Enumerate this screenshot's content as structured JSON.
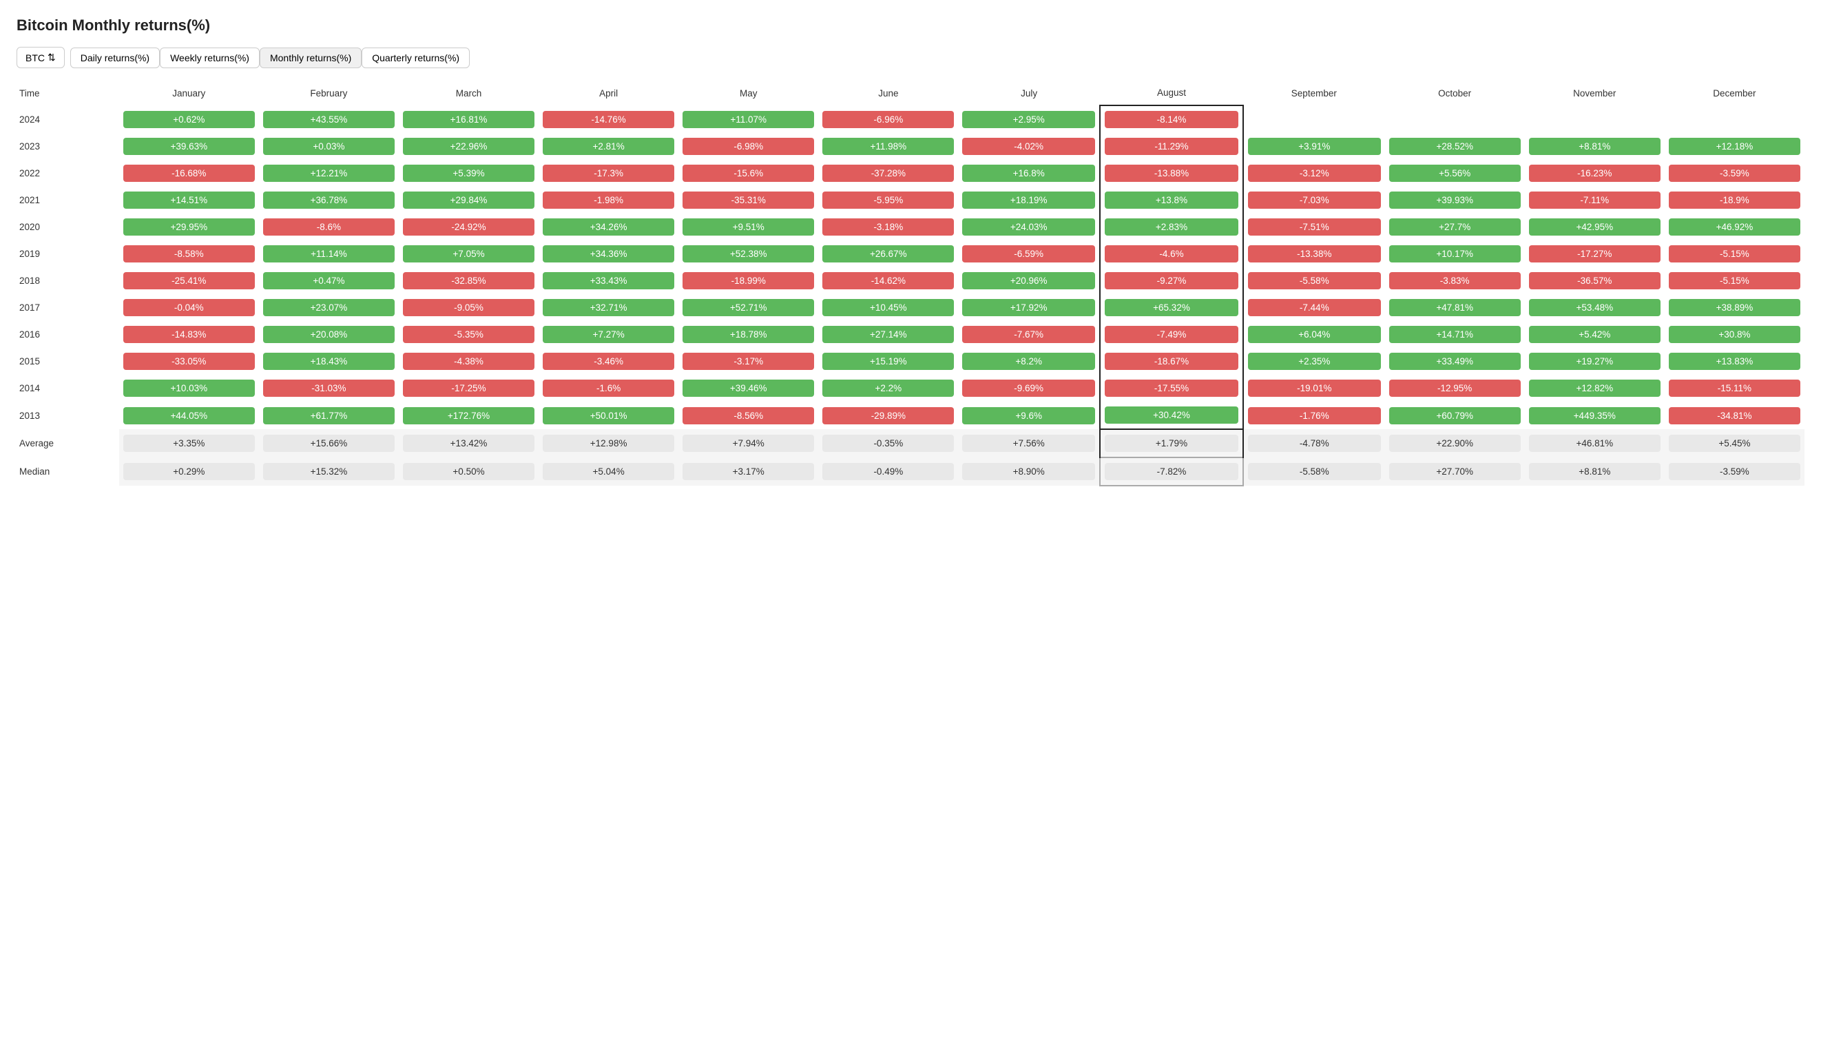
{
  "title": "Bitcoin Monthly returns(%)",
  "toolbar": {
    "asset": "BTC",
    "tabs": [
      {
        "label": "Daily returns(%)",
        "active": false
      },
      {
        "label": "Weekly returns(%)",
        "active": false
      },
      {
        "label": "Monthly returns(%)",
        "active": true
      },
      {
        "label": "Quarterly returns(%)",
        "active": false
      }
    ]
  },
  "columns": [
    "Time",
    "January",
    "February",
    "March",
    "April",
    "May",
    "June",
    "July",
    "August",
    "September",
    "October",
    "November",
    "December"
  ],
  "rows": [
    {
      "year": "2024",
      "values": [
        "+0.62%",
        "+43.55%",
        "+16.81%",
        "-14.76%",
        "+11.07%",
        "-6.96%",
        "+2.95%",
        "-8.14%",
        "",
        "",
        "",
        ""
      ]
    },
    {
      "year": "2023",
      "values": [
        "+39.63%",
        "+0.03%",
        "+22.96%",
        "+2.81%",
        "-6.98%",
        "+11.98%",
        "-4.02%",
        "-11.29%",
        "+3.91%",
        "+28.52%",
        "+8.81%",
        "+12.18%"
      ]
    },
    {
      "year": "2022",
      "values": [
        "-16.68%",
        "+12.21%",
        "+5.39%",
        "-17.3%",
        "-15.6%",
        "-37.28%",
        "+16.8%",
        "-13.88%",
        "-3.12%",
        "+5.56%",
        "-16.23%",
        "-3.59%"
      ]
    },
    {
      "year": "2021",
      "values": [
        "+14.51%",
        "+36.78%",
        "+29.84%",
        "-1.98%",
        "-35.31%",
        "-5.95%",
        "+18.19%",
        "+13.8%",
        "-7.03%",
        "+39.93%",
        "-7.11%",
        "-18.9%"
      ]
    },
    {
      "year": "2020",
      "values": [
        "+29.95%",
        "-8.6%",
        "-24.92%",
        "+34.26%",
        "+9.51%",
        "-3.18%",
        "+24.03%",
        "+2.83%",
        "-7.51%",
        "+27.7%",
        "+42.95%",
        "+46.92%"
      ]
    },
    {
      "year": "2019",
      "values": [
        "-8.58%",
        "+11.14%",
        "+7.05%",
        "+34.36%",
        "+52.38%",
        "+26.67%",
        "-6.59%",
        "-4.6%",
        "-13.38%",
        "+10.17%",
        "-17.27%",
        "-5.15%"
      ]
    },
    {
      "year": "2018",
      "values": [
        "-25.41%",
        "+0.47%",
        "-32.85%",
        "+33.43%",
        "-18.99%",
        "-14.62%",
        "+20.96%",
        "-9.27%",
        "-5.58%",
        "-3.83%",
        "-36.57%",
        "-5.15%"
      ]
    },
    {
      "year": "2017",
      "values": [
        "-0.04%",
        "+23.07%",
        "-9.05%",
        "+32.71%",
        "+52.71%",
        "+10.45%",
        "+17.92%",
        "+65.32%",
        "-7.44%",
        "+47.81%",
        "+53.48%",
        "+38.89%"
      ]
    },
    {
      "year": "2016",
      "values": [
        "-14.83%",
        "+20.08%",
        "-5.35%",
        "+7.27%",
        "+18.78%",
        "+27.14%",
        "-7.67%",
        "-7.49%",
        "+6.04%",
        "+14.71%",
        "+5.42%",
        "+30.8%"
      ]
    },
    {
      "year": "2015",
      "values": [
        "-33.05%",
        "+18.43%",
        "-4.38%",
        "-3.46%",
        "-3.17%",
        "+15.19%",
        "+8.2%",
        "-18.67%",
        "+2.35%",
        "+33.49%",
        "+19.27%",
        "+13.83%"
      ]
    },
    {
      "year": "2014",
      "values": [
        "+10.03%",
        "-31.03%",
        "-17.25%",
        "-1.6%",
        "+39.46%",
        "+2.2%",
        "-9.69%",
        "-17.55%",
        "-19.01%",
        "-12.95%",
        "+12.82%",
        "-15.11%"
      ]
    },
    {
      "year": "2013",
      "values": [
        "+44.05%",
        "+61.77%",
        "+172.76%",
        "+50.01%",
        "-8.56%",
        "-29.89%",
        "+9.6%",
        "+30.42%",
        "-1.76%",
        "+60.79%",
        "+449.35%",
        "-34.81%"
      ]
    }
  ],
  "averages": [
    "+3.35%",
    "+15.66%",
    "+13.42%",
    "+12.98%",
    "+7.94%",
    "-0.35%",
    "+7.56%",
    "+1.79%",
    "-4.78%",
    "+22.90%",
    "+46.81%",
    "+5.45%"
  ],
  "medians": [
    "+0.29%",
    "+15.32%",
    "+0.50%",
    "+5.04%",
    "+3.17%",
    "-0.49%",
    "+8.90%",
    "-7.82%",
    "-5.58%",
    "+27.70%",
    "+8.81%",
    "-3.59%"
  ]
}
